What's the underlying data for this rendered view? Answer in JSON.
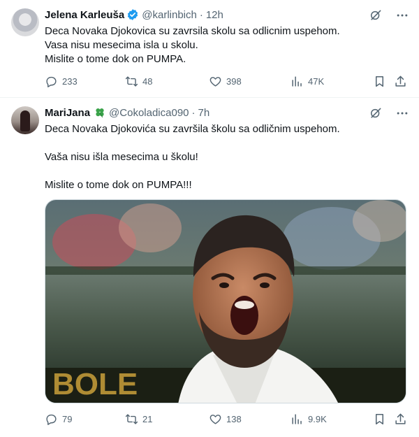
{
  "tweets": [
    {
      "author": "Jelena Karleuša",
      "handle": "@karlinbich",
      "separator": "·",
      "time": "12h",
      "lines": [
        "Deca Novaka Djokovica su zavrsila skolu sa odlicnim uspehom.",
        "Vasa nisu mesecima isla u skolu.",
        "Mislite o tome dok on PUMPA."
      ],
      "stats": {
        "replies": "233",
        "reposts": "48",
        "likes": "398",
        "views": "47K"
      }
    },
    {
      "author": "MariJana",
      "handle": "@Cokoladica090",
      "separator": "·",
      "time": "7h",
      "lines": [
        "Deca Novaka Djokovića su završila školu sa odličnim uspehom.",
        "",
        "Vaša nisu išla mesecima u školu!",
        "",
        "Mislite o tome dok on PUMPA!!!"
      ],
      "stats": {
        "replies": "79",
        "reposts": "21",
        "likes": "138",
        "views": "9.9K"
      }
    }
  ],
  "icons": {
    "verified": "verified-badge-icon",
    "clover": "four-leaf-clover-icon",
    "grok": "grok-icon",
    "more": "more-icon",
    "reply": "reply-icon",
    "repost": "repost-icon",
    "like": "like-icon",
    "views": "views-icon",
    "bookmark": "bookmark-icon",
    "share": "share-icon"
  },
  "colors": {
    "text": "#0f1419",
    "secondary": "#536471",
    "verified": "#1d9bf0",
    "clover": "#3aa34a",
    "border": "#eff3f4"
  }
}
